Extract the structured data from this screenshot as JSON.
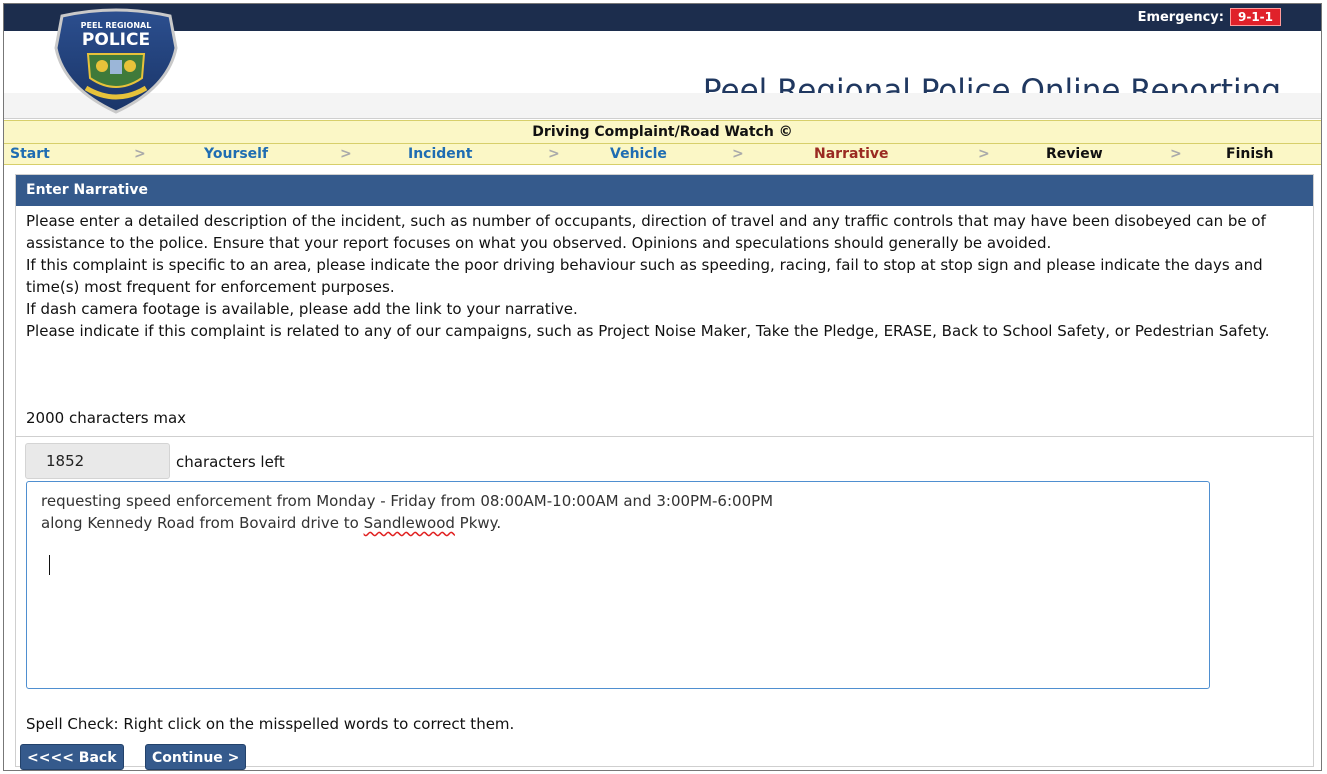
{
  "emergency": {
    "label": "Emergency:",
    "number": "9-1-1"
  },
  "site_title": "Peel Regional Police Online Reporting",
  "logo": {
    "text_top": "PEEL REGIONAL",
    "text_main": "POLICE"
  },
  "form_title": "Driving Complaint/Road Watch ©",
  "steps": [
    {
      "label": "Start",
      "state": "link"
    },
    {
      "label": "Yourself",
      "state": "link"
    },
    {
      "label": "Incident",
      "state": "link"
    },
    {
      "label": "Vehicle",
      "state": "link"
    },
    {
      "label": "Narrative",
      "state": "active"
    },
    {
      "label": "Review",
      "state": "future"
    },
    {
      "label": "Finish",
      "state": "future"
    }
  ],
  "step_separator": ">",
  "panel": {
    "title": "Enter Narrative",
    "instructions": [
      "Please enter a detailed description of the incident, such as number of occupants, direction of travel and any traffic controls that may have been disobeyed can be of assistance to the police. Ensure that your report focuses on what you observed. Opinions and speculations should generally be avoided.",
      "If this complaint is specific to an area, please indicate the poor driving behaviour such as speeding, racing, fail to stop at stop sign and please indicate the days and time(s) most frequent for enforcement purposes.",
      "If dash camera footage is available, please add the link to your narrative.",
      "Please indicate if this complaint is related to any of our campaigns, such as Project Noise Maker, Take the Pledge, ERASE, Back to School Safety, or Pedestrian Safety."
    ],
    "max_chars_text": "2000 characters max",
    "chars_left_value": "1852",
    "chars_left_label": "characters left",
    "narrative": {
      "line1": "requesting speed enforcement from Monday - Friday from 08:00AM-10:00AM and 3:00PM-6:00PM",
      "line2_before": "along Kennedy Road from Bovaird drive to ",
      "line2_misspelled": "Sandlewood",
      "line2_after": " Pkwy."
    },
    "spell_check_text": "Spell Check: Right click on the misspelled words to correct them."
  },
  "buttons": {
    "back": "<<<< Back",
    "continue": "Continue >"
  },
  "colors": {
    "header_dark": "#1c2d4d",
    "panel_blue": "#355a8c",
    "step_link": "#1f6db2",
    "step_active": "#9a2a22",
    "banner_yellow": "#fbf7c6"
  }
}
